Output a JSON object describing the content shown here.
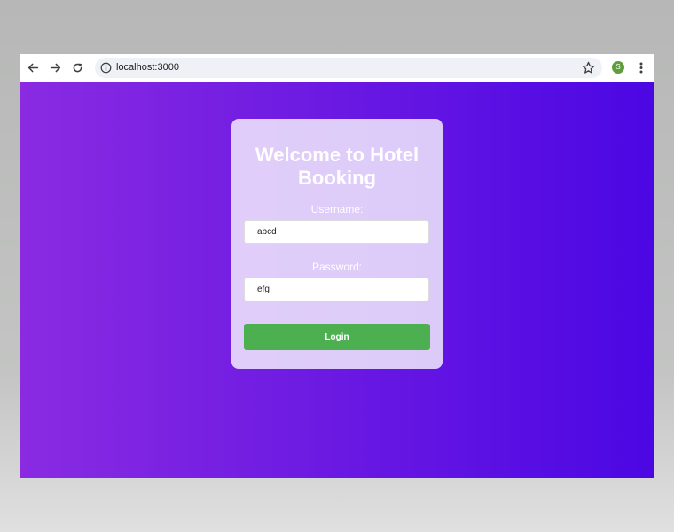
{
  "browser": {
    "url": "localhost:3000",
    "avatar_initial": "S",
    "icons": [
      "back-icon",
      "forward-icon",
      "reload-icon",
      "info-icon",
      "star-icon",
      "menu-icon"
    ]
  },
  "login": {
    "title": "Welcome to Hotel Booking",
    "username_label": "Username:",
    "username_value": "abcd",
    "password_label": "Password:",
    "password_value": "efg",
    "button_label": "Login"
  },
  "colors": {
    "gradient_start": "#8a2be2",
    "gradient_end": "#4b07e3",
    "button": "#4caf50",
    "avatar": "#5f9e3c"
  }
}
